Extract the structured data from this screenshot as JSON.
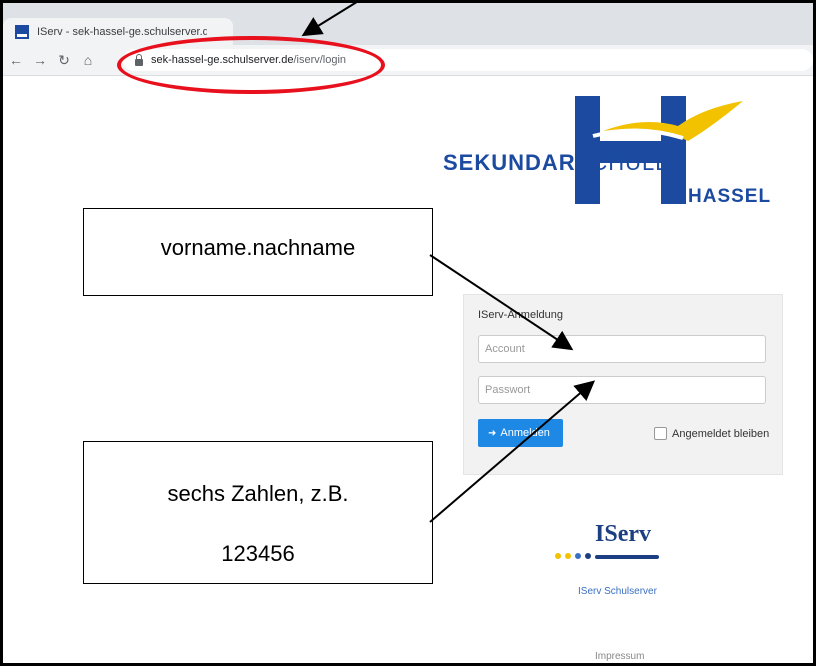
{
  "browser": {
    "tab_title": "IServ - sek-hassel-ge.schulserver.de",
    "url_host": "sek-hassel-ge.schulserver.de",
    "url_path": "/iserv/login",
    "nav_icons": [
      "back-icon",
      "forward-icon",
      "reload-icon",
      "home-icon"
    ]
  },
  "logo": {
    "line1_bold": "SEKUNDAR",
    "line1_light": "SCHULE",
    "line2": "HASSEL",
    "colors": {
      "blue": "#1b4aa0",
      "yellow": "#f2c200"
    }
  },
  "login": {
    "title": "IServ-Anmeldung",
    "account_placeholder": "Account",
    "password_placeholder": "Passwort",
    "login_button": "Anmelden",
    "remember_label": "Angemeldet bleiben"
  },
  "footer": {
    "iserv_logo_text": "IServ",
    "iserv_caption": "IServ Schulserver",
    "impressum": "Impressum"
  },
  "annotations": {
    "box1_text": "vorname.nachname",
    "box2_line1": "sechs Zahlen, z.B.",
    "box2_line2": "123456",
    "highlight_color": "#e8101d"
  }
}
